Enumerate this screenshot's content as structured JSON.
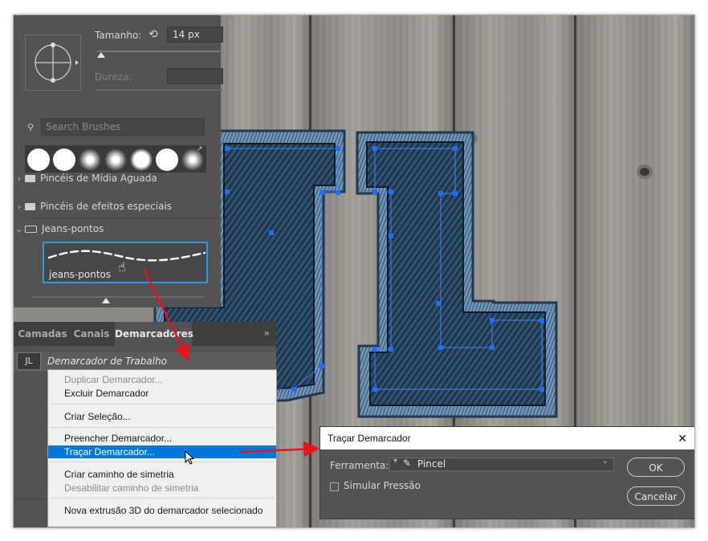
{
  "brush_panel": {
    "size_label": "Tamanho:",
    "size_value": "14 px",
    "hardness_label": "Dureza:",
    "search_placeholder": "Search Brushes",
    "folders": [
      {
        "label": "Pincéis de Mídia Aguada",
        "expanded": false
      },
      {
        "label": "Pincéis de efeitos especiais",
        "expanded": false
      },
      {
        "label": "Jeans-pontos",
        "expanded": true
      }
    ],
    "selected_brush": "jeans-pontos"
  },
  "paths_panel": {
    "tabs": [
      {
        "label": "Camadas",
        "active": false
      },
      {
        "label": "Canais",
        "active": false
      },
      {
        "label": "Demarcadores",
        "active": true
      }
    ],
    "collapse_glyph": "»",
    "path_name": "Demarcador de Trabalho"
  },
  "context_menu": {
    "items": [
      {
        "label": "Duplicar Demarcador...",
        "disabled": true
      },
      {
        "label": "Excluir Demarcador",
        "disabled": false
      },
      {
        "label": "Criar Seleção...",
        "disabled": false
      },
      {
        "label": "Preencher Demarcador...",
        "disabled": false
      },
      {
        "label": "Traçar Demarcador...",
        "disabled": false,
        "highlighted": true
      },
      {
        "label": "Criar caminho de simetria",
        "disabled": false
      },
      {
        "label": "Desabilitar caminho de simetria",
        "disabled": true
      },
      {
        "label": "Nova extrusão 3D do demarcador selecionado",
        "disabled": false
      }
    ]
  },
  "dialog": {
    "title": "Traçar Demarcador",
    "tool_label": "Ferramenta:",
    "tool_value": "Pincel",
    "simulate_label": "Simular Pressão",
    "simulate_checked": false,
    "ok_label": "OK",
    "cancel_label": "Cancelar",
    "close_glyph": "✕"
  },
  "colors": {
    "accent": "#0078d7",
    "selection_border": "#2b9be6",
    "arrow": "#e8141c",
    "panel": "#535353",
    "path_anchor": "#1e6fff"
  }
}
